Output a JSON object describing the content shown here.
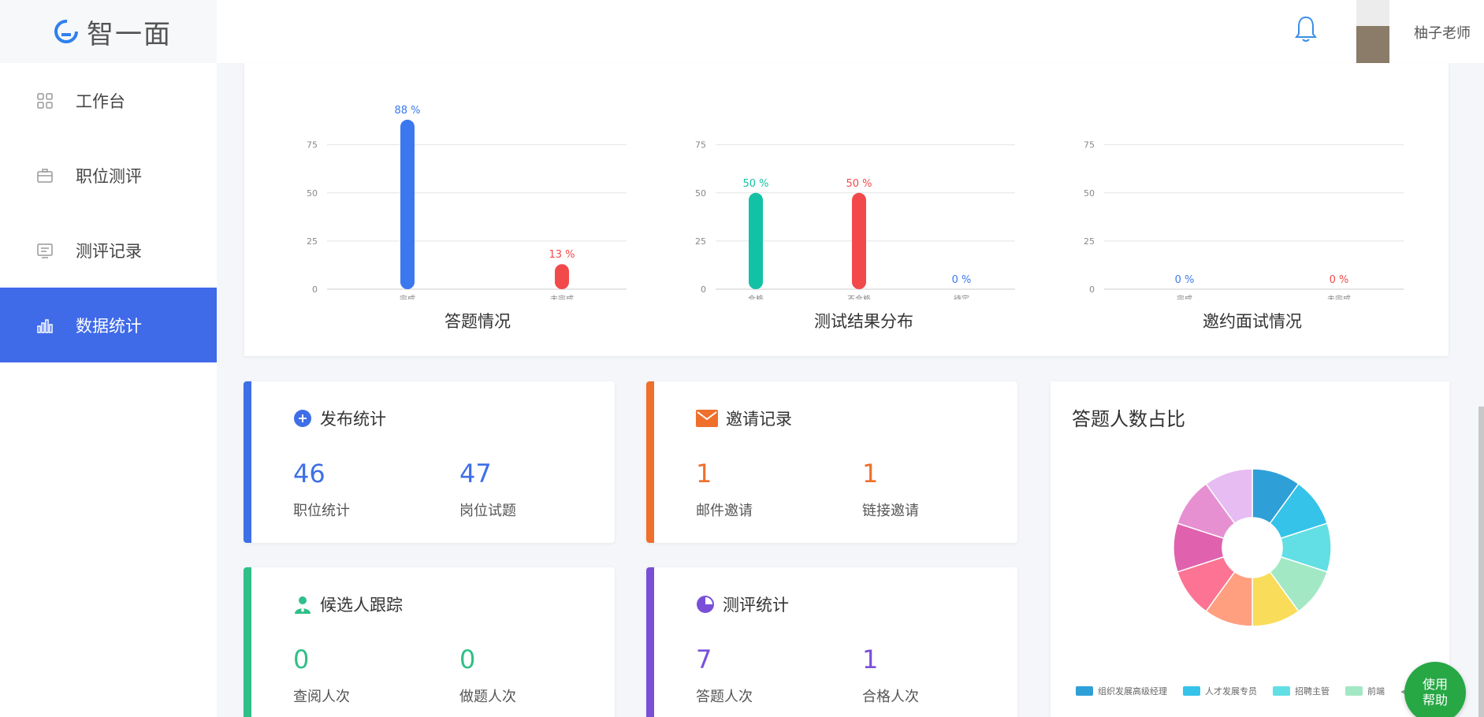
{
  "app": {
    "logo_text": "智一面",
    "user_name": "柚子老师"
  },
  "sidebar": {
    "items": [
      {
        "label": "工作台",
        "icon": "grid-icon"
      },
      {
        "label": "职位测评",
        "icon": "briefcase-icon"
      },
      {
        "label": "测评记录",
        "icon": "record-icon"
      },
      {
        "label": "数据统计",
        "icon": "bar-chart-icon",
        "active": true
      }
    ]
  },
  "chart_data": [
    {
      "type": "bar",
      "title": "答题情况",
      "categories": [
        "完成",
        "未完成"
      ],
      "values": [
        88,
        13
      ],
      "data_labels": [
        "88 %",
        "13 %"
      ],
      "colors": [
        "#3b78f0",
        "#f24a4a"
      ],
      "yticks": [
        0,
        25,
        50,
        75
      ],
      "ylim": [
        0,
        90
      ],
      "grid": true
    },
    {
      "type": "bar",
      "title": "测试结果分布",
      "categories": [
        "合格",
        "不合格",
        "待定"
      ],
      "values": [
        50,
        50,
        0
      ],
      "data_labels": [
        "50 %",
        "50 %",
        "0 %"
      ],
      "colors": [
        "#13c2a5",
        "#f24a4a",
        "#3b78f0"
      ],
      "yticks": [
        0,
        25,
        50,
        75
      ],
      "ylim": [
        0,
        90
      ],
      "grid": true
    },
    {
      "type": "bar",
      "title": "邀约面试情况",
      "categories": [
        "完成",
        "未完成"
      ],
      "values": [
        0,
        0
      ],
      "data_labels": [
        "0 %",
        "0 %"
      ],
      "colors": [
        "#3b78f0",
        "#f24a4a"
      ],
      "yticks": [
        0,
        25,
        50,
        75
      ],
      "ylim": [
        0,
        90
      ],
      "grid": true
    },
    {
      "type": "pie",
      "title": "答题人数占比",
      "legend": [
        "组织发展高级经理",
        "人才发展专员",
        "招聘主管",
        "前端"
      ],
      "slice_colors": [
        "#2f9fd8",
        "#35c3ea",
        "#62dfe4",
        "#a3e8c4",
        "#f9dd5a",
        "#ff9f7f",
        "#fc7393",
        "#e062ae",
        "#e690d1",
        "#e7bcf3"
      ],
      "legend_colors": [
        "#2f9fd8",
        "#35c3ea",
        "#62dfe4",
        "#a3e8c4"
      ]
    }
  ],
  "stats": {
    "publish": {
      "title": "发布统计",
      "color": "#3e6fe6",
      "icon": "plus-circle-icon",
      "items": [
        {
          "value": "46",
          "label": "职位统计"
        },
        {
          "value": "47",
          "label": "岗位试题"
        }
      ]
    },
    "invite": {
      "title": "邀请记录",
      "color": "#ef6f2b",
      "icon": "mail-icon",
      "items": [
        {
          "value": "1",
          "label": "邮件邀请"
        },
        {
          "value": "1",
          "label": "链接邀请"
        }
      ]
    },
    "candidate": {
      "title": "候选人跟踪",
      "color": "#2fbf88",
      "icon": "user-icon",
      "items": [
        {
          "value": "0",
          "label": "查阅人次"
        },
        {
          "value": "0",
          "label": "做题人次"
        }
      ]
    },
    "assess": {
      "title": "测评统计",
      "color": "#7a4fd8",
      "icon": "pie-icon",
      "items": [
        {
          "value": "7",
          "label": "答题人次"
        },
        {
          "value": "1",
          "label": "合格人次"
        }
      ]
    }
  },
  "help_button": {
    "line1": "使用",
    "line2": "帮助"
  }
}
